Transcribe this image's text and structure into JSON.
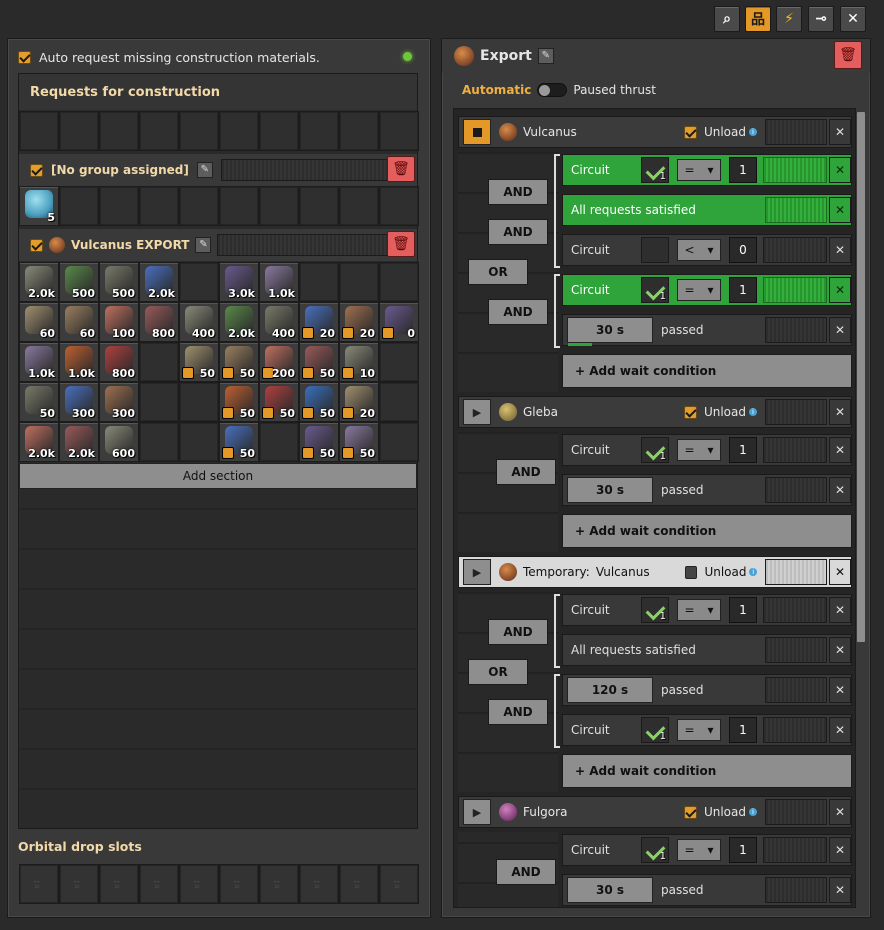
{
  "toolbar": {
    "icons": [
      "search-icon",
      "network-icon",
      "lightning-icon",
      "pin-icon",
      "close-icon"
    ]
  },
  "left": {
    "auto_request_label": "Auto request missing construction materials.",
    "requests_title": "Requests for construction",
    "group1": {
      "label": "[No group assigned]",
      "slots": [
        {
          "icon": "barrel",
          "count": "5",
          "color": "#4da0c0"
        }
      ]
    },
    "group2": {
      "label": "Vulcanus EXPORT"
    },
    "items": [
      [
        "2.0k",
        "500",
        "500",
        "2.0k",
        "",
        "3.0k",
        "1.0k",
        "",
        "",
        ""
      ],
      [
        "60",
        "60",
        "100",
        "800",
        "400",
        "2.0k",
        "400",
        "20",
        "20",
        "0"
      ],
      [
        "1.0k",
        "1.0k",
        "800",
        "",
        "50",
        "50",
        "200",
        "50",
        "10",
        ""
      ],
      [
        "50",
        "300",
        "300",
        "",
        "",
        "50",
        "50",
        "50",
        "20",
        ""
      ],
      [
        "2.0k",
        "2.0k",
        "600",
        "",
        "",
        "50",
        "",
        "50",
        "50",
        ""
      ]
    ],
    "add_section": "Add section",
    "orbital_title": "Orbital drop slots"
  },
  "right": {
    "title": "Export",
    "automatic": "Automatic",
    "paused": "Paused thrust",
    "stations": [
      {
        "name": "Vulcanus",
        "unload": "Unload"
      },
      {
        "name": "Gleba",
        "unload": "Unload"
      },
      {
        "prefix": "Temporary:",
        "name": "Vulcanus",
        "unload": "Unload"
      },
      {
        "name": "Fulgora",
        "unload": "Unload"
      }
    ],
    "cond": {
      "circuit": "Circuit",
      "all_req": "All requests satisfied",
      "passed": "passed",
      "eq": "=",
      "lt": "<",
      "one": "1",
      "zero": "0",
      "t30": "30 s",
      "t120": "120 s",
      "sig_n": "1"
    },
    "and": "AND",
    "or": "OR",
    "add_wait": "+ Add wait condition"
  }
}
